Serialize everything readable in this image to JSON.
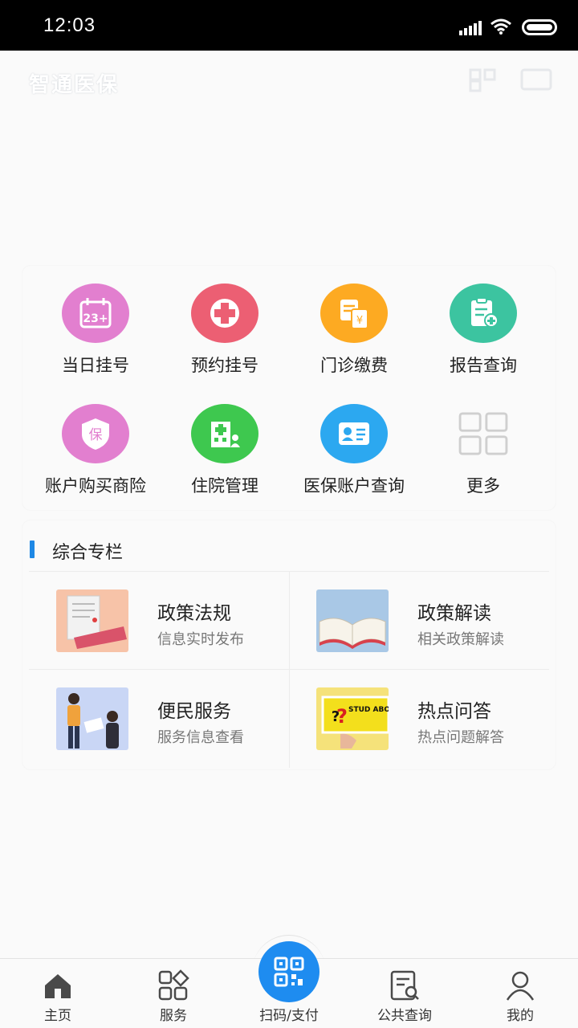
{
  "status_bar": {
    "time": "12:03"
  },
  "header": {
    "title": "智通医保"
  },
  "services": [
    {
      "label": "当日挂号",
      "icon": "calendar-icon",
      "color": "#e27fcf"
    },
    {
      "label": "预约挂号",
      "icon": "medical-cross-icon",
      "color": "#ec5f73"
    },
    {
      "label": "门诊缴费",
      "icon": "bill-payment-icon",
      "color": "#fdaa22"
    },
    {
      "label": "报告查询",
      "icon": "report-icon",
      "color": "#3cc4a0"
    },
    {
      "label": "账户购买商险",
      "icon": "insurance-shield-icon",
      "color": "#e27fcf"
    },
    {
      "label": "住院管理",
      "icon": "hospital-icon",
      "color": "#3ec84f"
    },
    {
      "label": "医保账户查询",
      "icon": "id-card-icon",
      "color": "#2ca8f0"
    },
    {
      "label": "更多",
      "icon": "grid-more-icon",
      "color": "#cfcfcf"
    }
  ],
  "section": {
    "title": "综合专栏",
    "topics": [
      {
        "title": "政策法规",
        "subtitle": "信息实时发布"
      },
      {
        "title": "政策解读",
        "subtitle": "相关政策解读"
      },
      {
        "title": "便民服务",
        "subtitle": "服务信息查看"
      },
      {
        "title": "热点问答",
        "subtitle": "热点问题解答"
      }
    ],
    "thumb_text": "STUD ABO"
  },
  "tabbar": {
    "tabs": [
      {
        "label": "主页",
        "icon": "home-icon"
      },
      {
        "label": "服务",
        "icon": "services-grid-icon"
      },
      {
        "label": "扫码/支付",
        "icon": "qr-code-icon"
      },
      {
        "label": "公共查询",
        "icon": "search-document-icon"
      },
      {
        "label": "我的",
        "icon": "user-icon"
      }
    ],
    "accent": "#1e8cf0"
  }
}
